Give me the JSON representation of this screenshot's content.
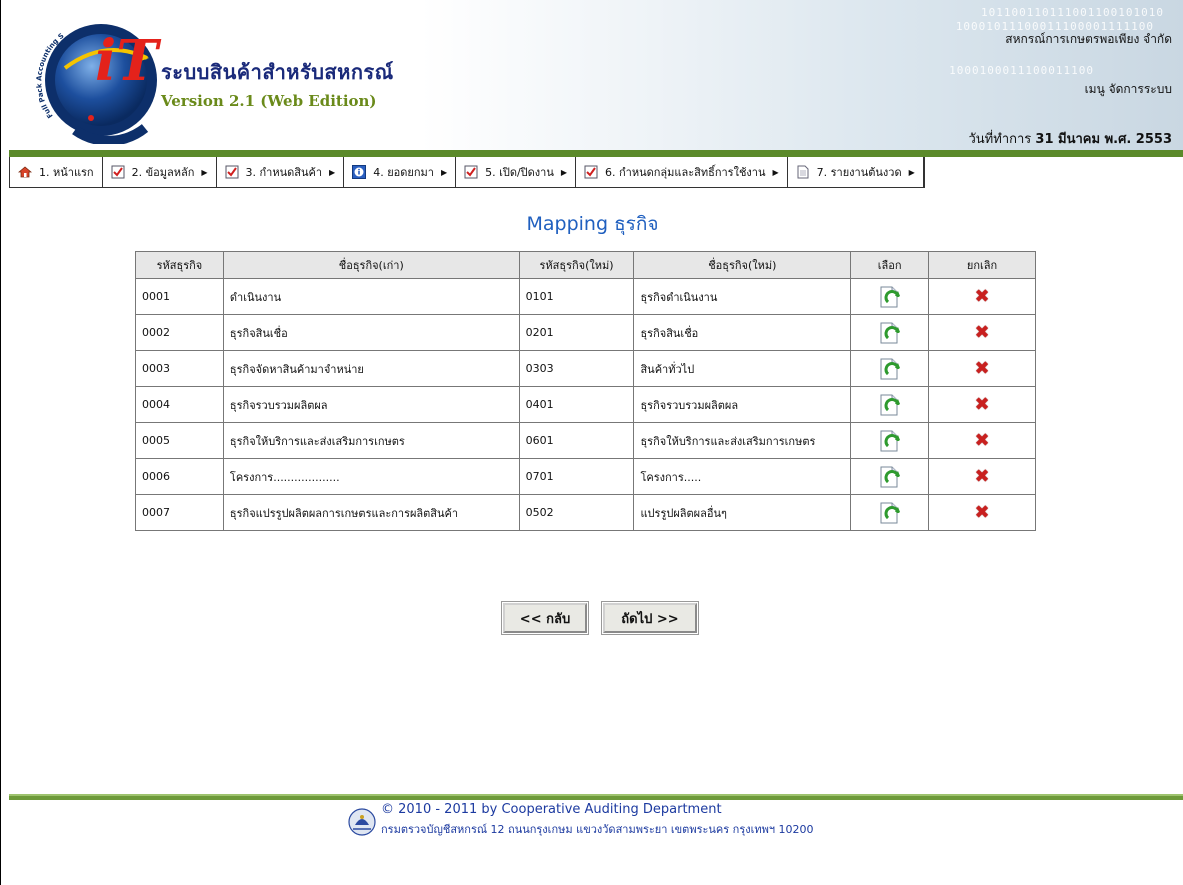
{
  "header": {
    "app_title": "ระบบสินค้าสำหรับสหกรณ์",
    "app_version": "Version 2.1 (Web Edition)",
    "coop_name": "สหกรณ์การเกษตรพอเพียง จำกัด",
    "menu_admin": "เมนู จัดการระบบ",
    "work_date_label": "วันที่ทำการ",
    "work_date_value": "31 มีนาคม พ.ศ. 2553",
    "logo_text": "iT",
    "logo_ring_text": "Full Pack Accounting Software : FAS",
    "binary_lines": [
      "101100110111001100101010",
      "10001011100011100001111100",
      "1000100011100011100"
    ]
  },
  "menu": [
    {
      "label": "1. หน้าแรก",
      "icon": "home-icon",
      "has_submenu": false
    },
    {
      "label": "2. ข้อมูลหลัก",
      "icon": "checklist-icon",
      "has_submenu": true
    },
    {
      "label": "3. กำหนดสินค้า",
      "icon": "checklist-icon",
      "has_submenu": true
    },
    {
      "label": "4. ยอดยกมา",
      "icon": "info-icon",
      "has_submenu": true
    },
    {
      "label": "5. เปิด/ปิดงาน",
      "icon": "checklist-icon",
      "has_submenu": true
    },
    {
      "label": "6. กำหนดกลุ่มและสิทธิ์การใช้งาน",
      "icon": "checklist-icon",
      "has_submenu": true
    },
    {
      "label": "7. รายงานต้นงวด",
      "icon": "document-icon",
      "has_submenu": true
    }
  ],
  "page_title": "Mapping ธุรกิจ",
  "table": {
    "headers": [
      "รหัสธุรกิจ",
      "ชื่อธุรกิจ(เก่า)",
      "รหัสธุรกิจ(ใหม่)",
      "ชื่อธุรกิจ(ใหม่)",
      "เลือก",
      "ยกเลิก"
    ],
    "rows": [
      {
        "old_code": "0001",
        "old_name": "ดำเนินงาน",
        "new_code": "0101",
        "new_name": "ธุรกิจดำเนินงาน"
      },
      {
        "old_code": "0002",
        "old_name": "ธุรกิจสินเชื่อ",
        "new_code": "0201",
        "new_name": "ธุรกิจสินเชื่อ"
      },
      {
        "old_code": "0003",
        "old_name": "ธุรกิจจัดหาสินค้ามาจำหน่าย",
        "new_code": "0303",
        "new_name": "สินค้าทั่วไป"
      },
      {
        "old_code": "0004",
        "old_name": "ธุรกิจรวบรวมผลิตผล",
        "new_code": "0401",
        "new_name": "ธุรกิจรวบรวมผลิตผล"
      },
      {
        "old_code": "0005",
        "old_name": "ธุรกิจให้บริการและส่งเสริมการเกษตร",
        "new_code": "0601",
        "new_name": "ธุรกิจให้บริการและส่งเสริมการเกษตร"
      },
      {
        "old_code": "0006",
        "old_name": "โครงการ...................",
        "new_code": "0701",
        "new_name": "โครงการ....."
      },
      {
        "old_code": "0007",
        "old_name": "ธุรกิจแปรรูปผลิตผลการเกษตรและการผลิตสินค้า",
        "new_code": "0502",
        "new_name": "แปรรูปผลิตผลอื่นๆ"
      }
    ]
  },
  "buttons": {
    "back": "<< กลับ",
    "next": "ถัดไป >>"
  },
  "footer": {
    "copyright": "© 2010 - 2011  by Cooperative Auditing Department",
    "address": "กรมตรวจบัญชีสหกรณ์ 12 ถนนกรุงเกษม แขวงวัดสามพระยา เขตพระนคร กรุงเทพฯ 10200"
  },
  "colors": {
    "accent_green": "#5b8a2a",
    "title_blue": "#1f5fbf",
    "delete_red": "#c9201f"
  }
}
